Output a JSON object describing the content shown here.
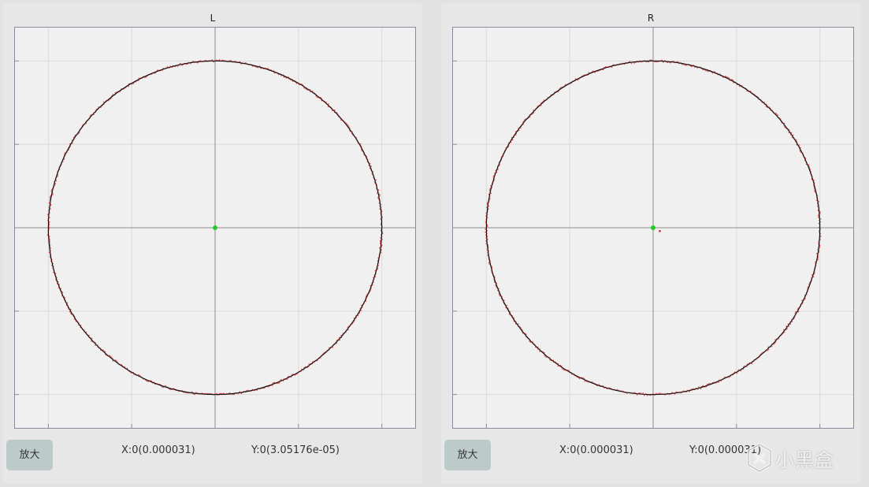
{
  "panels": [
    {
      "title": "L",
      "zoom_label": "放大",
      "x_readout": "X:0(0.000031)",
      "y_readout": "Y:0(3.05176e-05)",
      "stray_point": null
    },
    {
      "title": "R",
      "zoom_label": "放大",
      "x_readout": "X:0(0.000031)",
      "y_readout": "Y:0(0.000031)",
      "stray_point": [
        0.04,
        -0.02
      ]
    }
  ],
  "chart_data": [
    {
      "type": "scatter",
      "title": "L",
      "xlim": [
        -1.2,
        1.2
      ],
      "ylim": [
        -1.2,
        1.2
      ],
      "grid": true,
      "series": [
        {
          "shape": "circle",
          "center": [
            0,
            0
          ],
          "radius": 1.0,
          "color": "#111111"
        },
        {
          "shape": "circle-scatter",
          "center": [
            0,
            0
          ],
          "radius": 1.0,
          "color": "#d42020"
        }
      ],
      "center_marker": {
        "x": 0,
        "y": 0,
        "color": "#22cc22"
      }
    },
    {
      "type": "scatter",
      "title": "R",
      "xlim": [
        -1.2,
        1.2
      ],
      "ylim": [
        -1.2,
        1.2
      ],
      "grid": true,
      "series": [
        {
          "shape": "circle",
          "center": [
            0,
            0
          ],
          "radius": 1.0,
          "color": "#111111"
        },
        {
          "shape": "circle-scatter",
          "center": [
            0,
            0
          ],
          "radius": 1.0,
          "color": "#d42020"
        }
      ],
      "center_marker": {
        "x": 0,
        "y": 0,
        "color": "#22cc22"
      }
    }
  ],
  "watermark": {
    "text": "小黑盒",
    "icon": "xiaoheihe-logo-icon"
  },
  "colors": {
    "panel_bg": "#e7e7e7",
    "plot_bg": "#f0f0f0",
    "grid": "#dadada",
    "axis": "#8c8c8c",
    "button_bg": "#bccac9"
  }
}
